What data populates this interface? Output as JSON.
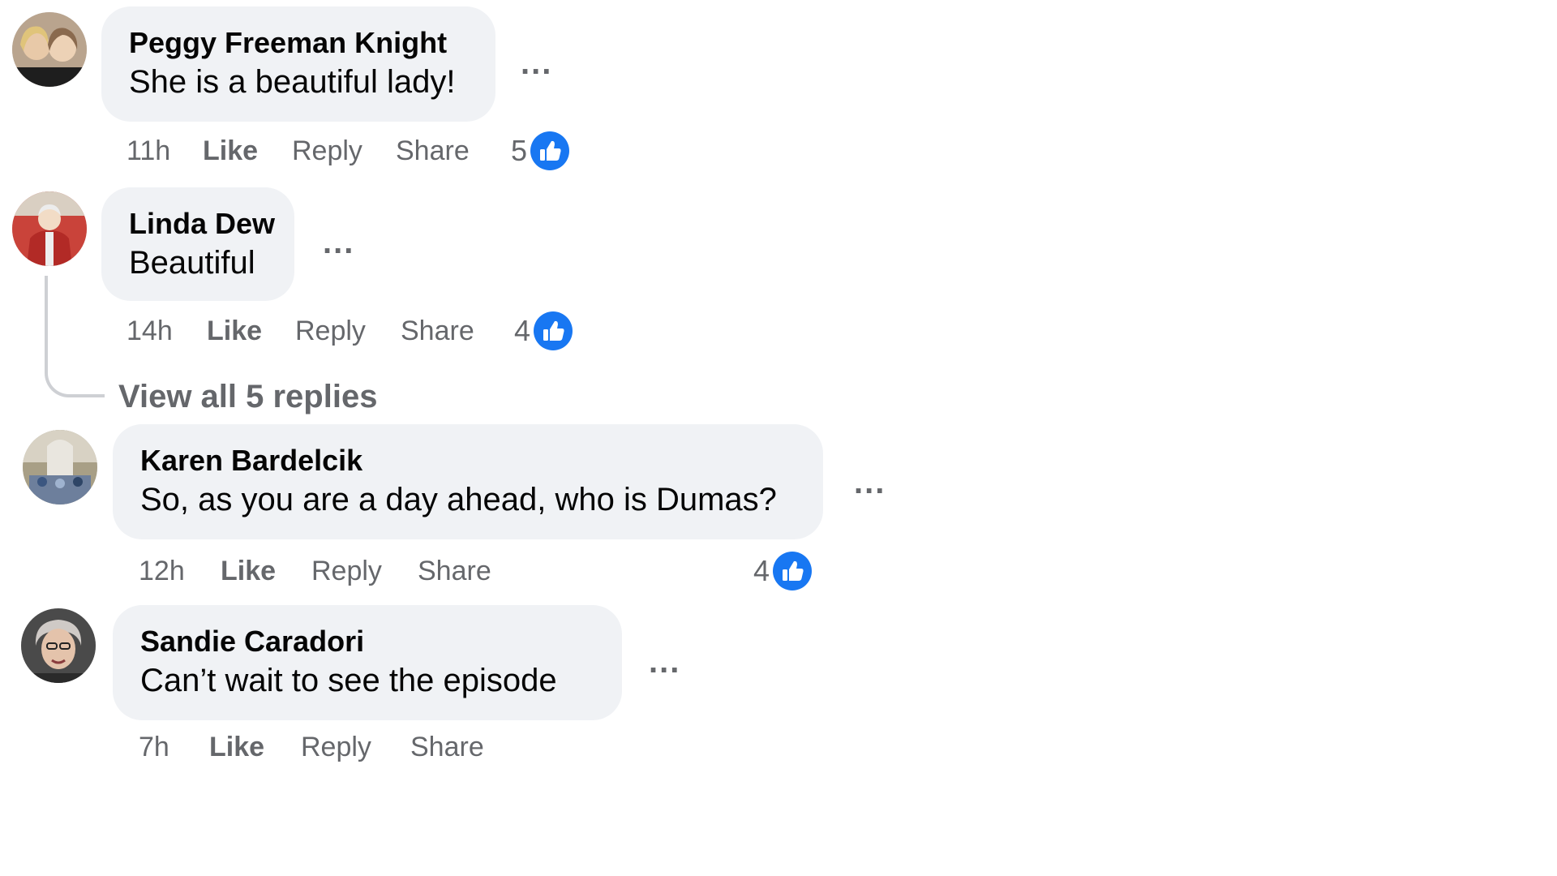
{
  "comments": [
    {
      "author": "Peggy Freeman Knight",
      "text": "She is a beautiful lady!",
      "time": "11h",
      "like_label": "Like",
      "reply_label": "Reply",
      "share_label": "Share",
      "reaction_count": "5",
      "more_label": "..."
    },
    {
      "author": "Linda Dew",
      "text": "Beautiful",
      "time": "14h",
      "like_label": "Like",
      "reply_label": "Reply",
      "share_label": "Share",
      "reaction_count": "4",
      "more_label": "...",
      "view_replies_label": "View all 5 replies"
    },
    {
      "author": "Karen Bardelcik",
      "text": "So, as you are a day ahead, who is Dumas?",
      "time": "12h",
      "like_label": "Like",
      "reply_label": "Reply",
      "share_label": "Share",
      "reaction_count": "4",
      "more_label": "..."
    },
    {
      "author": "Sandie Caradori",
      "text": "Can’t wait to see the episode",
      "time": "7h",
      "like_label": "Like",
      "reply_label": "Reply",
      "share_label": "Share",
      "more_label": "..."
    }
  ],
  "colors": {
    "bubble": "#f0f2f5",
    "secondary_text": "#65676b",
    "like_blue": "#1877f2"
  },
  "icons": {
    "reaction": "like-thumb-icon",
    "more": "more-options-icon"
  }
}
